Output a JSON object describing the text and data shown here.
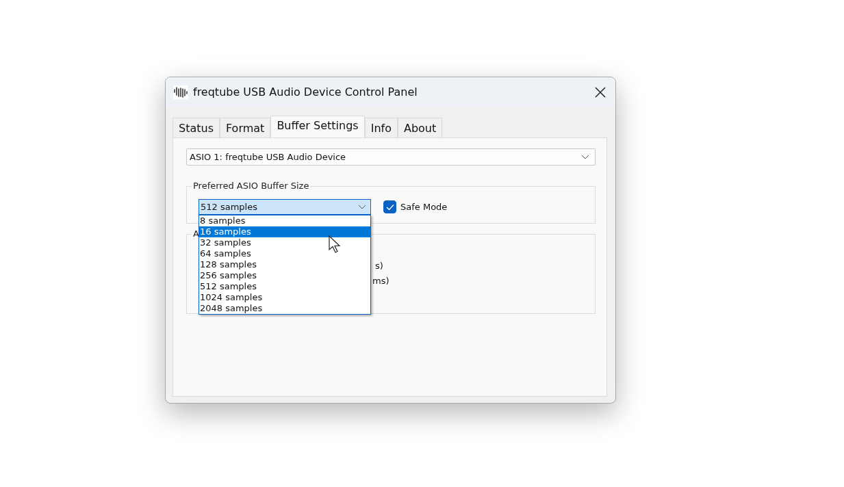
{
  "window": {
    "title": "freqtube USB Audio Device Control Panel"
  },
  "tabs": [
    {
      "label": "Status",
      "selected": false
    },
    {
      "label": "Format",
      "selected": false
    },
    {
      "label": "Buffer Settings",
      "selected": true
    },
    {
      "label": "Info",
      "selected": false
    },
    {
      "label": "About",
      "selected": false
    }
  ],
  "device_select": {
    "value": "ASIO 1: freqtube USB Audio Device"
  },
  "buffer_group": {
    "legend": "Preferred ASIO Buffer Size",
    "select": {
      "value": "512 samples",
      "expanded": true
    },
    "safe_mode": {
      "label": "Safe Mode",
      "checked": true
    }
  },
  "dropdown_options": [
    {
      "label": "8 samples",
      "selected": false
    },
    {
      "label": "16 samples",
      "selected": true
    },
    {
      "label": "32 samples",
      "selected": false
    },
    {
      "label": "64 samples",
      "selected": false
    },
    {
      "label": "128 samples",
      "selected": false
    },
    {
      "label": "256 samples",
      "selected": false
    },
    {
      "label": "512 samples",
      "selected": false
    },
    {
      "label": "1024 samples",
      "selected": false
    },
    {
      "label": "2048 samples",
      "selected": false
    }
  ],
  "second_group": {
    "legend": "A",
    "lines": [
      "s)",
      "ms)"
    ]
  }
}
